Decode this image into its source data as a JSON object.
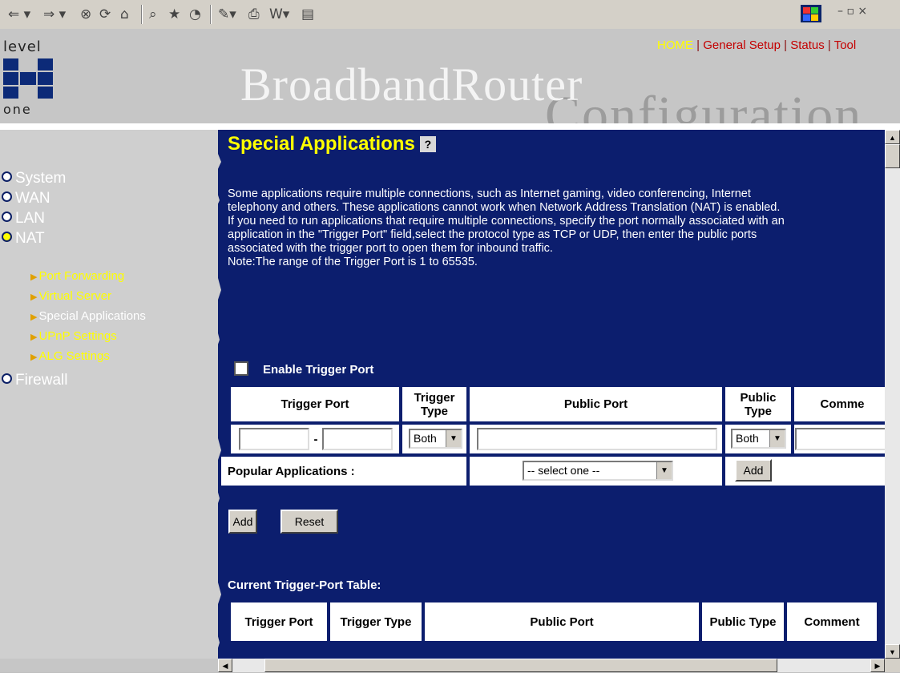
{
  "toolbar": {
    "icons": [
      "back-icon",
      "forward-icon",
      "stop-icon",
      "refresh-icon",
      "home-icon",
      "search-icon",
      "favorites-icon",
      "history-icon",
      "edit-icon",
      "print-icon",
      "word-icon",
      "discuss-icon"
    ],
    "window_controls": "– ▫ ×"
  },
  "header": {
    "logo_top": "level",
    "logo_bottom": "one",
    "brand": "BroadbandRouter",
    "brand_sub": "Configuration",
    "nav": {
      "home": "HOME",
      "separator": " | ",
      "general_setup": "General Setup",
      "status": "Status",
      "tools": "Tool"
    }
  },
  "sidebar": {
    "items": [
      {
        "label": "System"
      },
      {
        "label": "WAN"
      },
      {
        "label": "LAN"
      },
      {
        "label": "NAT"
      },
      {
        "label": "Firewall"
      }
    ],
    "nat_sub": [
      {
        "label": "Port Forwarding"
      },
      {
        "label": "Virtual Server"
      },
      {
        "label": "Special Applications"
      },
      {
        "label": "UPnP Settings"
      },
      {
        "label": "ALG Settings"
      }
    ]
  },
  "main": {
    "title": "Special Applications",
    "help": "?",
    "description": "Some applications require multiple connections, such as Internet gaming, video conferencing, Internet telephony and others. These applications cannot work when Network Address Translation (NAT) is enabled. If you need to run applications that require multiple connections, specify the port normally associated with an application in the \"Trigger Port\" field,select the protocol type as TCP or UDP, then enter the public ports associated with the trigger port to open them for inbound traffic.",
    "note": "Note:The range of the Trigger Port is 1 to 65535.",
    "enable_label": "Enable Trigger Port",
    "form_headers": {
      "trigger_port": "Trigger Port",
      "trigger_type": "Trigger Type",
      "public_port": "Public Port",
      "public_type": "Public Type",
      "comment": "Comme"
    },
    "range_dash": "-",
    "trigger_type_value": "Both",
    "public_type_value": "Both",
    "popular_label": "Popular Applications :",
    "popular_select": "-- select one --",
    "popular_add": "Add",
    "add_button": "Add",
    "reset_button": "Reset",
    "current_title": "Current Trigger-Port Table:",
    "table_headers": {
      "trigger_port": "Trigger Port",
      "trigger_type": "Trigger Type",
      "public_port": "Public Port",
      "public_type": "Public Type",
      "comment": "Comment"
    }
  }
}
